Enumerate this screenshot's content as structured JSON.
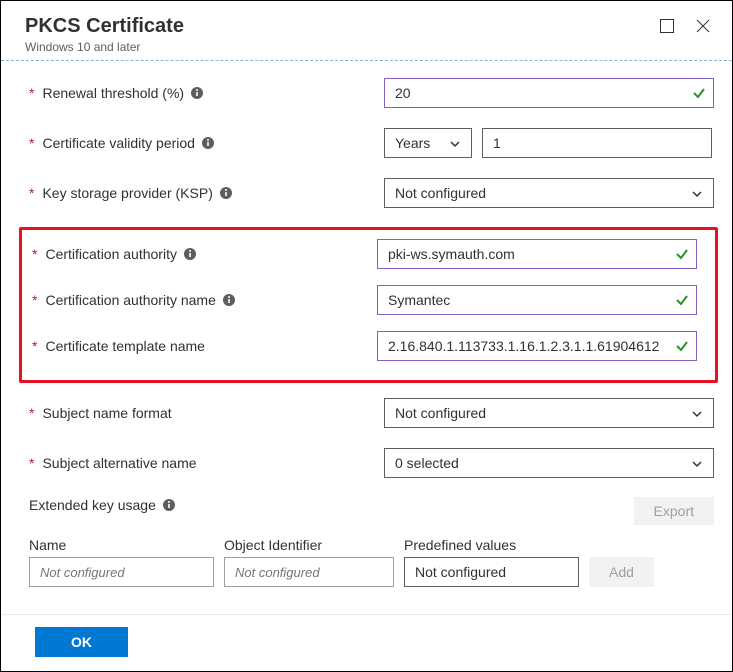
{
  "header": {
    "title": "PKCS Certificate",
    "subtitle": "Windows 10 and later"
  },
  "fields": {
    "renewal": {
      "label": "Renewal threshold (%)",
      "value": "20"
    },
    "validity": {
      "label": "Certificate validity period",
      "unit": "Years",
      "num": "1"
    },
    "ksp": {
      "label": "Key storage provider (KSP)",
      "value": "Not configured"
    },
    "ca": {
      "label": "Certification authority",
      "value": "pki-ws.symauth.com"
    },
    "caName": {
      "label": "Certification authority name",
      "value": "Symantec"
    },
    "templateName": {
      "label": "Certificate template name",
      "value": "2.16.840.1.113733.1.16.1.2.3.1.1.61904612"
    },
    "subjNameFmt": {
      "label": "Subject name format",
      "value": "Not configured"
    },
    "san": {
      "label": "Subject alternative name",
      "value": "0 selected"
    }
  },
  "eku": {
    "label": "Extended key usage",
    "exportBtn": "Export",
    "cols": {
      "name": "Name",
      "oid": "Object Identifier",
      "predef": "Predefined values"
    },
    "placeholders": {
      "name": "Not configured",
      "oid": "Not configured",
      "predef": "Not configured"
    },
    "addBtn": "Add"
  },
  "footer": {
    "ok": "OK"
  }
}
